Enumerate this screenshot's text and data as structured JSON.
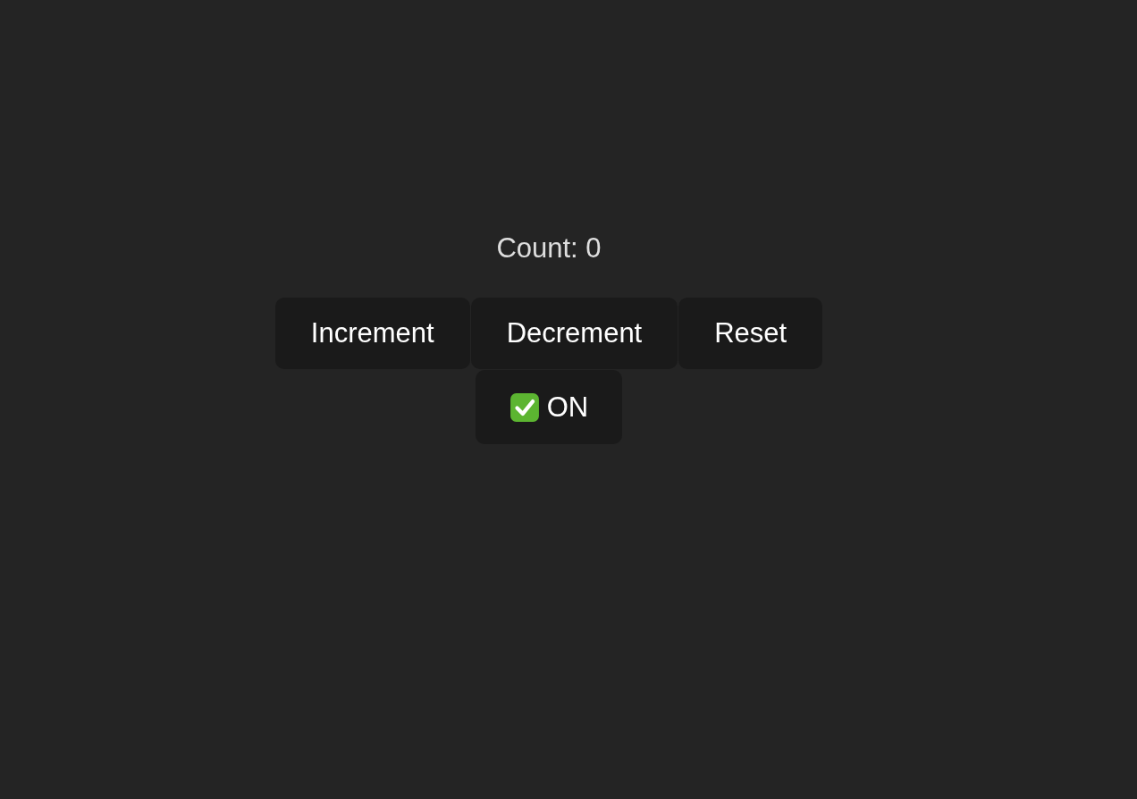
{
  "count_label": "Count: 0",
  "buttons": [
    {
      "label": "Increment"
    },
    {
      "label": "Decrement"
    },
    {
      "label": "Reset"
    }
  ],
  "toggle": {
    "label": "ON",
    "on": true
  }
}
